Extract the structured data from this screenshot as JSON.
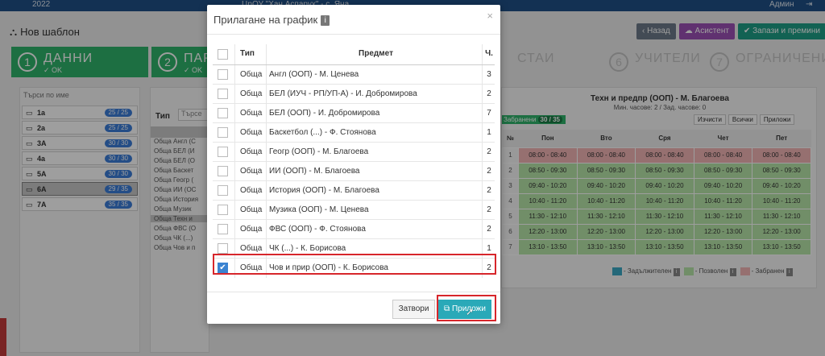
{
  "app": {
    "year": "2022",
    "school": "ЦрОУ \"Хан Аспарух\" - с. Яна",
    "user": "Админ",
    "page_title": "Нов шаблон",
    "buttons": {
      "back": "Назад",
      "assistant": "Асистент",
      "save": "Запази и премини"
    },
    "wizard": [
      {
        "num": "1",
        "label": "ДАННИ",
        "status": "✓ OK"
      },
      {
        "num": "2",
        "label": "ПАР",
        "status": "✓ OK"
      },
      {
        "num": "",
        "label": "СТАИ",
        "status": ""
      },
      {
        "num": "6",
        "label": "УЧИТЕЛИ",
        "status": ""
      },
      {
        "num": "7",
        "label": "ОГРАНИЧЕНИЯ",
        "status": ""
      }
    ],
    "class_search_placeholder": "Търси по име",
    "classes": [
      {
        "name": "1а",
        "badge": "25 / 25"
      },
      {
        "name": "2а",
        "badge": "25 / 25"
      },
      {
        "name": "3А",
        "badge": "30 / 30"
      },
      {
        "name": "4а",
        "badge": "30 / 30"
      },
      {
        "name": "5А",
        "badge": "30 / 30"
      },
      {
        "name": "6А",
        "badge": "29 / 35"
      },
      {
        "name": "7А",
        "badge": "35 / 35"
      }
    ],
    "mid_type_label": "Тип",
    "mid_search": "Търсе",
    "mid_rows": [
      "Обща  Англ (С",
      "Обща  БЕЛ (И",
      "Обща  БЕЛ (О",
      "Обща  Баскет",
      "Обща  Геогр (",
      "Обща  ИИ (ОС",
      "Обща  История",
      "Обща  Музик",
      "Обща  Техн и",
      "Обща  ФВС (О",
      "Обща  ЧК (...)",
      "Обща  Чов и п"
    ],
    "sched": {
      "title": "Техн и предпр (ООП) - М. Благоева",
      "sub": "Мин. часове: 2 / Зад. часове: 0",
      "badge_label": "Забранени",
      "badge_value": "30 / 35",
      "btn_clear": "Изчисти",
      "btn_all": "Всички",
      "btn_apply": "Приложи",
      "head": [
        "№",
        "Пон",
        "Вто",
        "Сря",
        "Чет",
        "Пет"
      ],
      "rows": [
        {
          "n": "1",
          "t": "08:00 - 08:40"
        },
        {
          "n": "2",
          "t": "08:50 - 09:30"
        },
        {
          "n": "3",
          "t": "09:40 - 10:20"
        },
        {
          "n": "4",
          "t": "10:40 - 11:20"
        },
        {
          "n": "5",
          "t": "11:30 - 12:10"
        },
        {
          "n": "6",
          "t": "12:20 - 13:00"
        },
        {
          "n": "7",
          "t": "13:10 - 13:50"
        }
      ],
      "legend": {
        "required": "- Задължителен",
        "allowed": "- Позволен",
        "forbidden": "- Забранен"
      }
    }
  },
  "colors": {
    "green": "#2fb36b",
    "teal": "#2aa9b8",
    "red_outline": "#d7262b",
    "checkbox_blue": "#3b83d1"
  },
  "modal": {
    "title": "Прилагане на график",
    "close": "×",
    "headers": {
      "type": "Тип",
      "subject": "Предмет",
      "hours": "Ч."
    },
    "rows": [
      {
        "type": "Обща",
        "subject": "Англ (ООП) - М. Ценева",
        "hours": "3",
        "checked": false
      },
      {
        "type": "Обща",
        "subject": "БЕЛ (ИУЧ - РП/УП-А) - И. Добромирова",
        "hours": "2",
        "checked": false
      },
      {
        "type": "Обща",
        "subject": "БЕЛ (ООП) - И. Добромирова",
        "hours": "7",
        "checked": false
      },
      {
        "type": "Обща",
        "subject": "Баскетбол (...) - Ф. Стоянова",
        "hours": "1",
        "checked": false
      },
      {
        "type": "Обща",
        "subject": "Геогр (ООП) - М. Благоева",
        "hours": "2",
        "checked": false
      },
      {
        "type": "Обща",
        "subject": "ИИ (ООП) - М. Благоева",
        "hours": "2",
        "checked": false
      },
      {
        "type": "Обща",
        "subject": "История (ООП) - М. Благоева",
        "hours": "2",
        "checked": false
      },
      {
        "type": "Обща",
        "subject": "Музика (ООП) - М. Ценева",
        "hours": "2",
        "checked": false
      },
      {
        "type": "Обща",
        "subject": "ФВС (ООП) - Ф. Стоянова",
        "hours": "2",
        "checked": false
      },
      {
        "type": "Обща",
        "subject": "ЧК (...) - К. Борисова",
        "hours": "1",
        "checked": false
      },
      {
        "type": "Обща",
        "subject": "Чов и прир (ООП) - К. Борисова",
        "hours": "2",
        "checked": true
      }
    ],
    "btn_close": "Затвори",
    "btn_apply": "Приложи"
  }
}
